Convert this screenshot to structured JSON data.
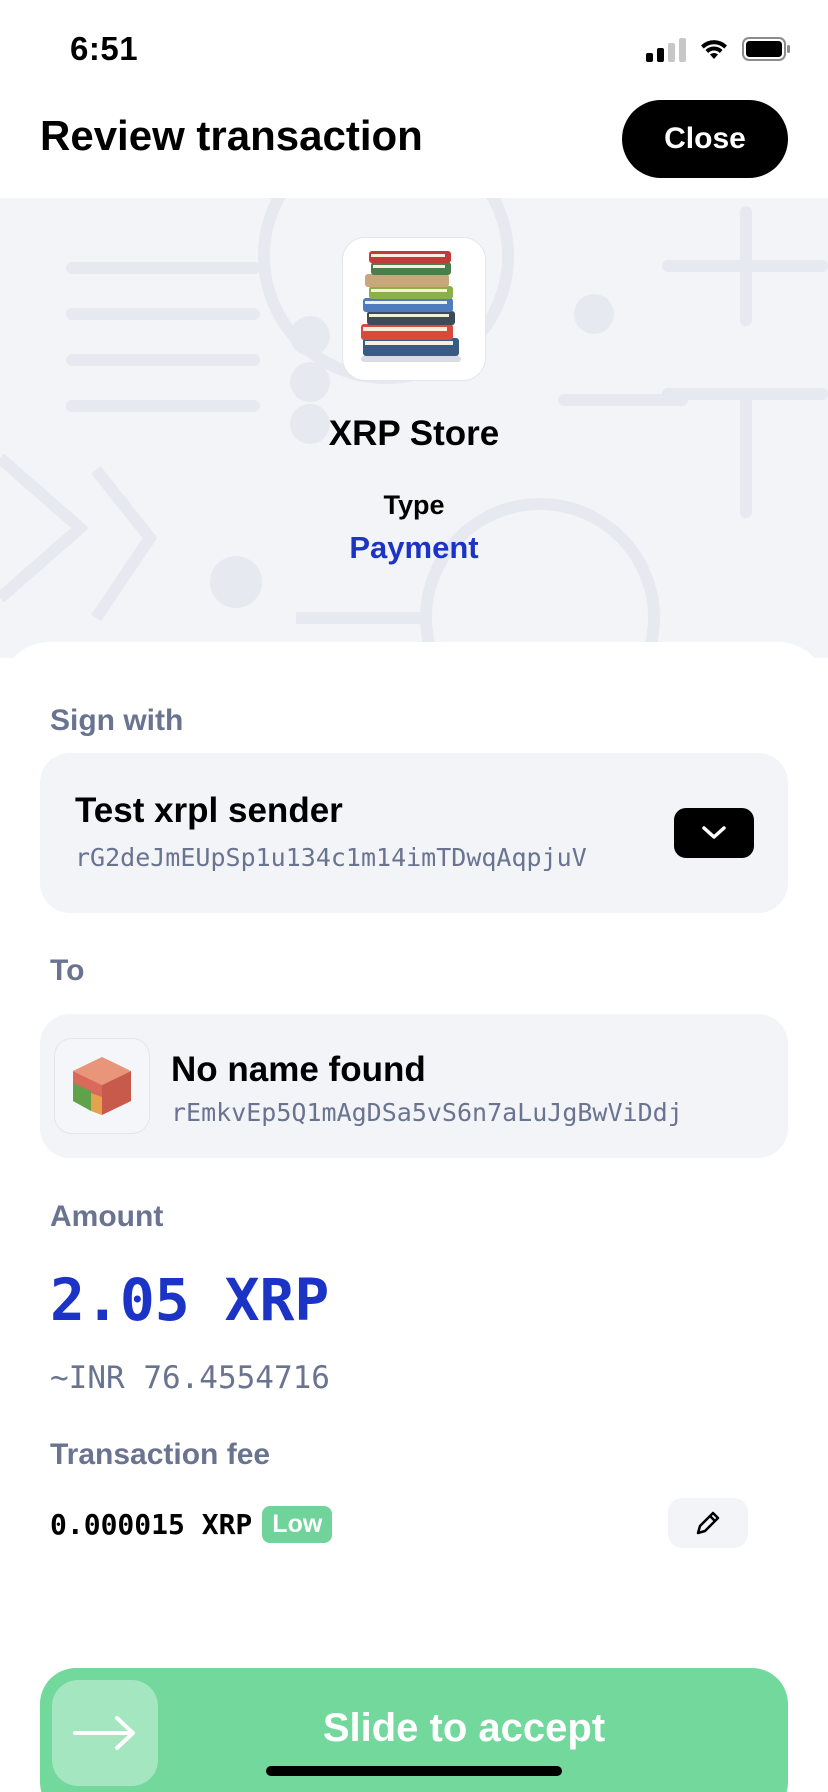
{
  "status_bar": {
    "time": "6:51"
  },
  "header": {
    "title": "Review transaction",
    "close_label": "Close"
  },
  "app": {
    "name": "XRP Store",
    "type_label": "Type",
    "type_value": "Payment"
  },
  "sign_with": {
    "label": "Sign with",
    "account_name": "Test xrpl sender",
    "account_address": "rG2deJmEUpSp1u134c1m14imTDwqAqpjuV"
  },
  "to": {
    "label": "To",
    "name": "No name found",
    "address": "rEmkvEp5Q1mAgDSa5vS6n7aLuJgBwViDdj"
  },
  "amount": {
    "label": "Amount",
    "value": "2.05 XRP",
    "fiat": "~INR 76.4554716"
  },
  "fee": {
    "label": "Transaction fee",
    "value": "0.000015 XRP",
    "level": "Low"
  },
  "slider": {
    "label": "Slide to accept"
  },
  "colors": {
    "accent_blue": "#1c34c5",
    "success_green": "#72d89c",
    "muted_text": "#6a7390",
    "card_bg": "#f2f4f8"
  },
  "icons": {
    "signal": "cellular-signal-icon",
    "wifi": "wifi-icon",
    "battery": "battery-icon",
    "dropdown": "chevron-down-icon",
    "edit": "pencil-icon",
    "slide": "arrow-right-icon",
    "avatar": "cube-avatar-icon",
    "app": "books-icon"
  }
}
